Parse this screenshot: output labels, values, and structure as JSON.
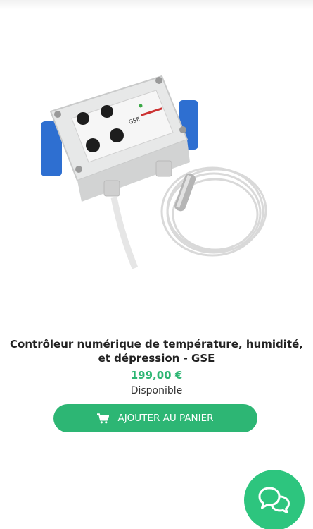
{
  "product": {
    "title": "Contrôleur numérique de température, humidité, et dépression - GSE",
    "price": "199,00 €",
    "availability": "Disponible",
    "image_label_brand": "GSE"
  },
  "cart_button": {
    "label": "AJOUTER AU PANIER",
    "icon": "shopping-cart-icon"
  },
  "chat": {
    "icon": "chat-bubbles-icon"
  },
  "colors": {
    "accent": "#2db674",
    "price": "#2cb673",
    "chat": "#2dc57e"
  }
}
